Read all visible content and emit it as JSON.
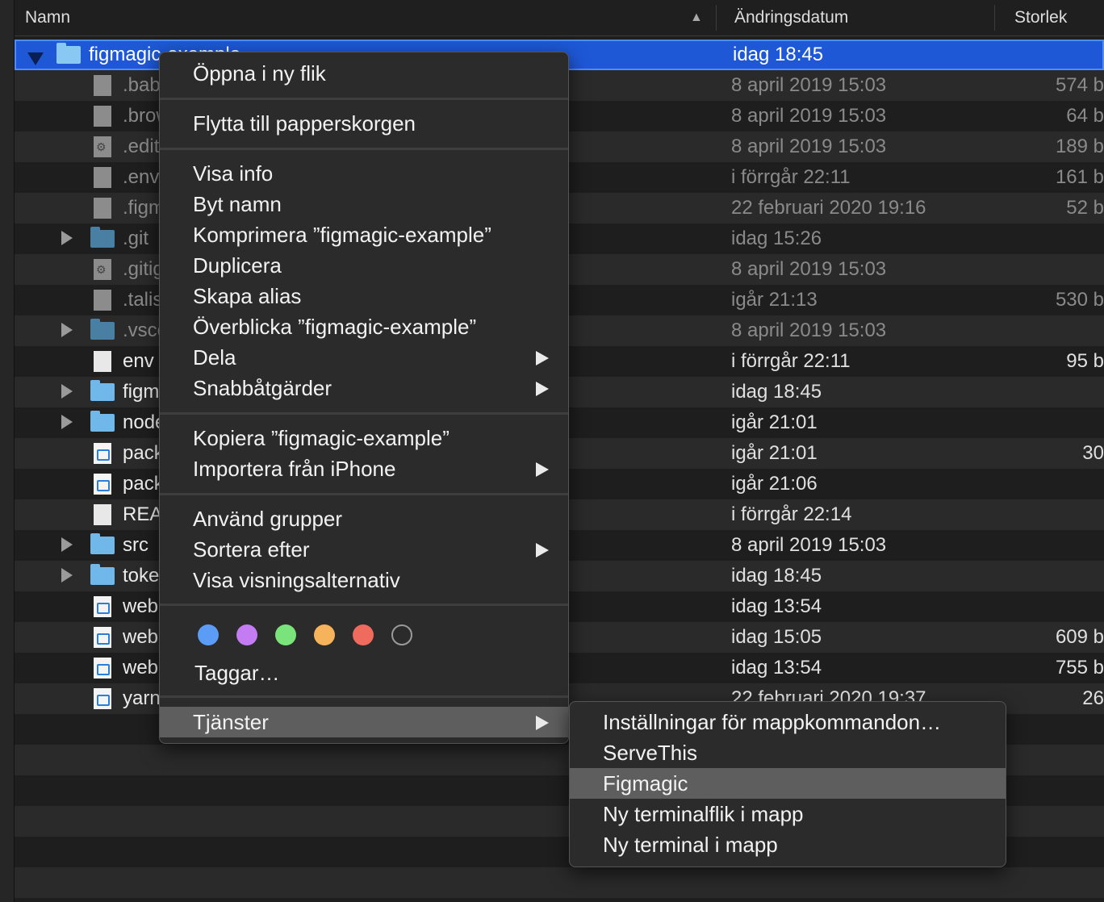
{
  "header": {
    "name_col": "Namn",
    "date_col": "Ändringsdatum",
    "size_col": "Storlek"
  },
  "selected_row": {
    "name": "figmagic-example",
    "date": "idag 18:45"
  },
  "rows": [
    {
      "name": ".babelrc",
      "date": "8 april 2019 15:03",
      "size": "574 b",
      "icon": "file-icon",
      "dim": true
    },
    {
      "name": ".browserslistrc",
      "date": "8 april 2019 15:03",
      "size": "64 b",
      "icon": "file-icon",
      "dim": true
    },
    {
      "name": ".editorconfig",
      "date": "8 april 2019 15:03",
      "size": "189 b",
      "icon": "gear-file-icon",
      "dim": true
    },
    {
      "name": ".env",
      "date": "i förrgår 22:11",
      "size": "161 b",
      "icon": "file-icon",
      "dim": true
    },
    {
      "name": ".figmagicrc",
      "date": "22 februari 2020 19:16",
      "size": "52 b",
      "icon": "file-icon",
      "dim": true
    },
    {
      "name": ".git",
      "date": "idag 15:26",
      "size": "",
      "icon": "folder-icon",
      "dim": true
    },
    {
      "name": ".gitignore",
      "date": "8 april 2019 15:03",
      "size": "",
      "icon": "gear-file-icon",
      "dim": true
    },
    {
      "name": ".talisman",
      "date": "igår 21:13",
      "size": "530 b",
      "icon": "file-icon",
      "dim": true
    },
    {
      "name": ".vscode",
      "date": "8 april 2019 15:03",
      "size": "",
      "icon": "folder-icon",
      "dim": true
    },
    {
      "name": "env",
      "date": "i förrgår 22:11",
      "size": "95 b",
      "icon": "file-icon",
      "dim": false
    },
    {
      "name": "figmagic",
      "date": "idag 18:45",
      "size": "",
      "icon": "folder-icon",
      "dim": false
    },
    {
      "name": "node_modules",
      "date": "igår 21:01",
      "size": "",
      "icon": "folder-icon",
      "dim": false
    },
    {
      "name": "package-lock.json",
      "date": "igår 21:01",
      "size": "30",
      "icon": "vscode-file-icon",
      "dim": false
    },
    {
      "name": "package.json",
      "date": "igår 21:06",
      "size": "",
      "icon": "vscode-file-icon",
      "dim": false
    },
    {
      "name": "README.md",
      "date": "i förrgår 22:14",
      "size": "",
      "icon": "file-icon",
      "dim": false
    },
    {
      "name": "src",
      "date": "8 april 2019 15:03",
      "size": "",
      "icon": "folder-icon",
      "dim": false
    },
    {
      "name": "tokens",
      "date": "idag 18:45",
      "size": "",
      "icon": "folder-icon",
      "dim": false
    },
    {
      "name": "webpack.config.js",
      "date": "idag 13:54",
      "size": "",
      "icon": "vscode-file-icon",
      "dim": false
    },
    {
      "name": "webpack.dev.js",
      "date": "idag 15:05",
      "size": "609 b",
      "icon": "vscode-file-icon",
      "dim": false
    },
    {
      "name": "webpack.prod.js",
      "date": "idag 13:54",
      "size": "755 b",
      "icon": "vscode-file-icon",
      "dim": false
    },
    {
      "name": "yarn.lock",
      "date": "22 februari 2020 19:37",
      "size": "26",
      "icon": "vscode-file-icon",
      "dim": false
    }
  ],
  "context_menu": {
    "open_new_tab": "Öppna i ny flik",
    "move_to_trash": "Flytta till papperskorgen",
    "get_info": "Visa info",
    "rename": "Byt namn",
    "compress": "Komprimera ”figmagic-example”",
    "duplicate": "Duplicera",
    "make_alias": "Skapa alias",
    "quick_look": "Överblicka ”figmagic-example”",
    "share": "Dela",
    "quick_actions": "Snabbåtgärder",
    "copy": "Kopiera ”figmagic-example”",
    "import_iphone": "Importera från iPhone",
    "use_groups": "Använd grupper",
    "sort_by": "Sortera efter",
    "view_options": "Visa visningsalternativ",
    "tags": "Taggar…",
    "services": "Tjänster"
  },
  "tag_colors": [
    "#5b9cf7",
    "#c37cf2",
    "#7ae37b",
    "#f6b35c",
    "#ee6b5e",
    "none"
  ],
  "services_menu": {
    "folder_actions": "Inställningar för mappkommandon…",
    "serve_this": "ServeThis",
    "figmagic": "Figmagic",
    "new_terminal_tab": "Ny terminalflik i mapp",
    "new_terminal": "Ny terminal i mapp"
  }
}
